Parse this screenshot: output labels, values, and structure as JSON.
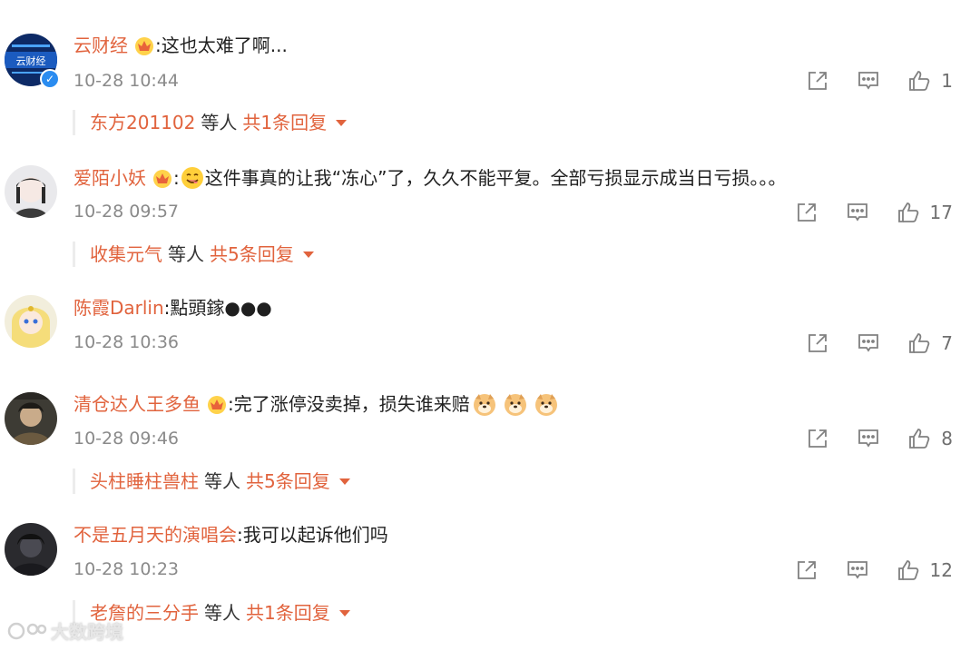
{
  "comments": [
    {
      "user": "云财经",
      "crown": true,
      "verified": true,
      "emoji": false,
      "text": ":这也太难了啊...",
      "time": "10-28 10:44",
      "likes": "1",
      "reply": {
        "name": "东方201102",
        "etc": "等人",
        "total": "共1条回复"
      },
      "avatar_icon": "yuncaijing-logo-avatar"
    },
    {
      "user": "爱陌小妖",
      "crown": true,
      "verified": false,
      "emoji": true,
      "pre": ":",
      "text": "这件事真的让我“冻心”了，久久不能平复。全部亏损显示成当日亏损。。。",
      "time": "10-28 09:57",
      "likes": "17",
      "reply": {
        "name": "收集元气",
        "etc": "等人",
        "total": "共5条回复"
      },
      "avatar_icon": "anime-girl-avatar"
    },
    {
      "user": "陈霞Darlin",
      "crown": false,
      "verified": false,
      "emoji": false,
      "text": ":點頭鎵●●●",
      "time": "10-28 10:36",
      "likes": "7",
      "reply": null,
      "avatar_icon": "sailor-avatar"
    },
    {
      "user": "清仓达人王多鱼",
      "crown": true,
      "verified": false,
      "emoji": false,
      "text": ":完了涨停没卖掉，损失谁来赔",
      "doge_count": 3,
      "time": "10-28 09:46",
      "likes": "8",
      "reply": {
        "name": "头柱睡柱兽柱",
        "etc": "等人",
        "total": "共5条回复"
      },
      "avatar_icon": "warrior-avatar"
    },
    {
      "user": "不是五月天的演唱会",
      "crown": false,
      "verified": false,
      "emoji": false,
      "text": ":我可以起诉他们吗",
      "time": "10-28 10:23",
      "likes": "12",
      "reply": {
        "name": "老詹的三分手",
        "etc": "等人",
        "total": "共1条回复"
      },
      "avatar_icon": "dark-figure-avatar"
    }
  ],
  "watermark": "大数跨境",
  "colors": {
    "username": "#e1633d",
    "time": "#8a8a8a",
    "icon": "#808080"
  }
}
